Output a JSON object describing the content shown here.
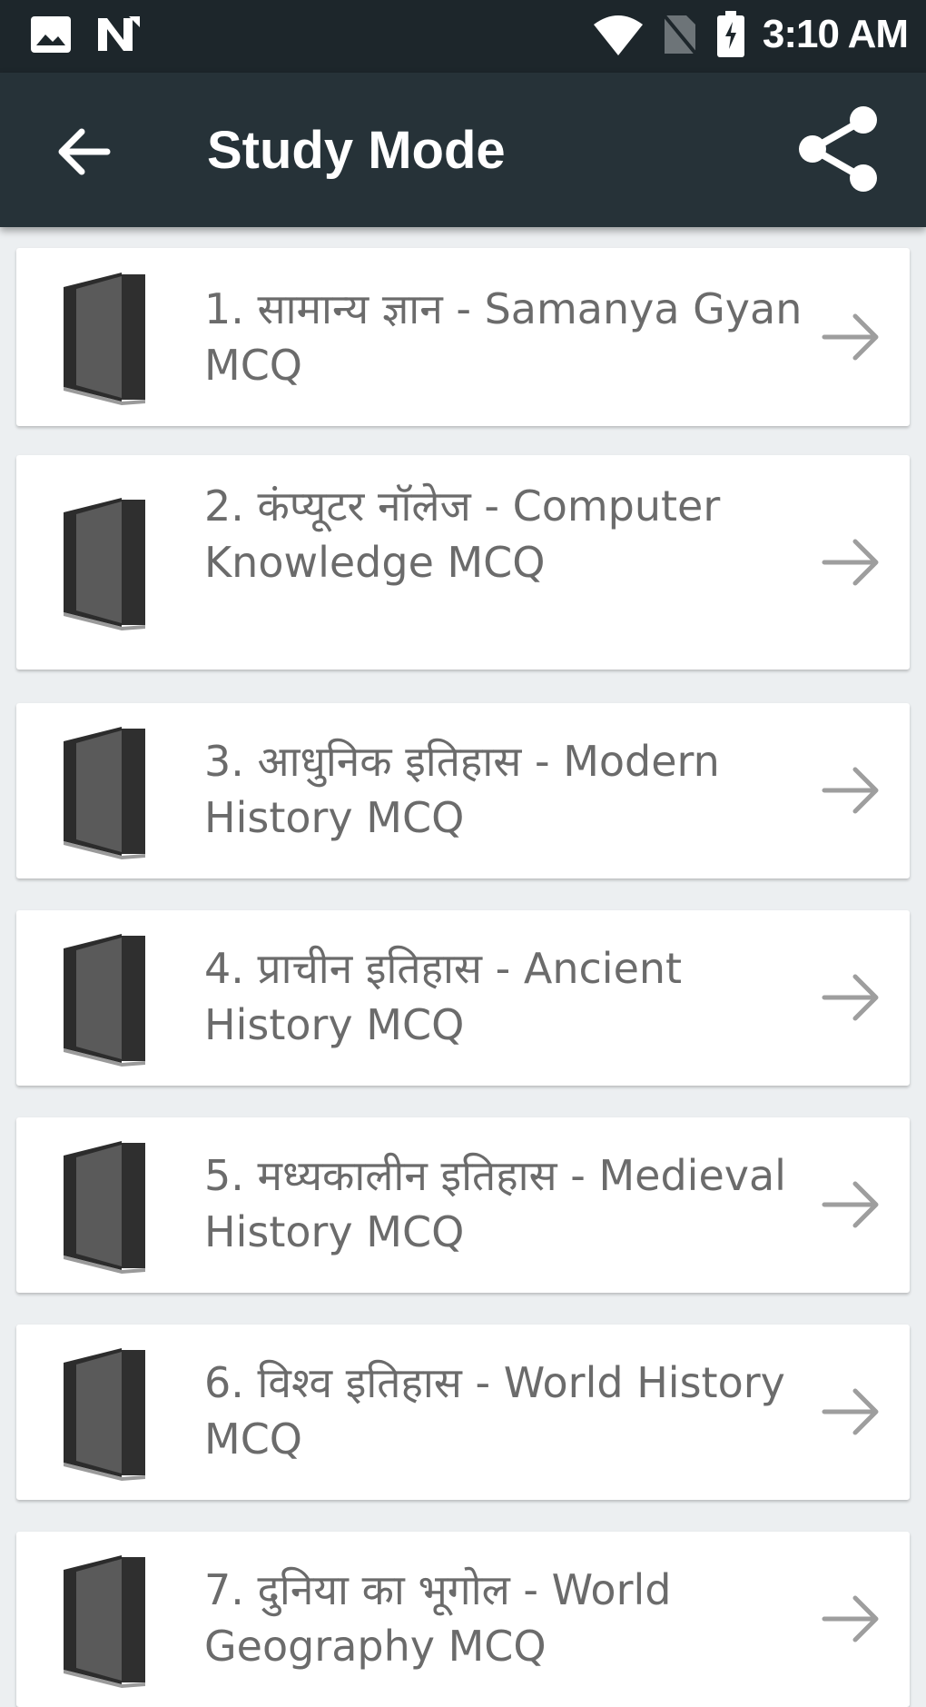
{
  "status_bar": {
    "time": "3:10 AM",
    "icons": [
      "image-icon",
      "notification-n-icon",
      "wifi-icon",
      "no-sim-icon",
      "battery-icon"
    ]
  },
  "app_bar": {
    "title": "Study Mode",
    "back_icon": "arrow-back-icon",
    "share_icon": "share-icon"
  },
  "items": [
    {
      "label": "1. सामान्य ज्ञान - Samanya Gyan MCQ"
    },
    {
      "label": "2. कंप्यूटर नॉलेज - Computer Knowledge MCQ"
    },
    {
      "label": "3. आधुनिक इतिहास - Modern History MCQ"
    },
    {
      "label": "4. प्राचीन इतिहास - Ancient History MCQ"
    },
    {
      "label": "5. मध्यकालीन इतिहास - Medieval History MCQ"
    },
    {
      "label": "6. विश्व इतिहास - World History MCQ"
    },
    {
      "label": "7. दुनिया का भूगोल - World Geography MCQ"
    }
  ],
  "colors": {
    "status_bar": "#1d262b",
    "app_bar": "#263238",
    "background": "#eceff1",
    "card": "#ffffff",
    "text": "#6b6b6b",
    "arrow": "#9e9e9e"
  }
}
